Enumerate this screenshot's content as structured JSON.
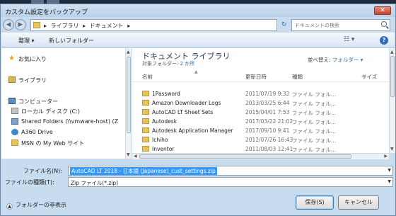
{
  "window": {
    "title": "カスタム設定をバックアップ",
    "close_label": "✕"
  },
  "address": {
    "crumbs": [
      "ライブラリ",
      "ドキュメント"
    ],
    "separator": "▸",
    "search_placeholder": "ドキュメントの検索"
  },
  "toolbar": {
    "organize_label": "整理 ▾",
    "new_folder_label": "新しいフォルダー",
    "views_label": "☷ ▾",
    "help_label": "?"
  },
  "nav": {
    "items": [
      {
        "label": "お気に入り",
        "icon": "star-icon"
      },
      {
        "label": "ライブラリ",
        "icon": "library-icon"
      },
      {
        "label": "コンピューター",
        "icon": "computer-icon"
      },
      {
        "label": "ローカル ディスク (C:)",
        "icon": "disk-icon"
      },
      {
        "label": "Shared Folders (\\\\vmware-host) (Z",
        "icon": "network-drive-icon"
      },
      {
        "label": "A360 Drive",
        "icon": "a360-icon"
      },
      {
        "label": "MSN の My Web サイト",
        "icon": "msn-icon"
      }
    ]
  },
  "library": {
    "title": "ドキュメント ライブラリ",
    "subtitle_prefix": "対象フォルダー: ",
    "location_count": "2 か所",
    "arrange_label": "並べ替え: ",
    "arrange_value": "フォルダー ▾"
  },
  "columns": {
    "name": "名前",
    "date": "更新日時",
    "type": "種類",
    "size": "サイズ"
  },
  "files": [
    {
      "name": "1Password",
      "date": "2011/07/19 9:32",
      "type": "ファイル フォル..."
    },
    {
      "name": "Amazon Downloader Logs",
      "date": "2013/03/25 6:44",
      "type": "ファイル フォル..."
    },
    {
      "name": "AutoCAD LT Sheet Sets",
      "date": "2015/04/01 7:53",
      "type": "ファイル フォル..."
    },
    {
      "name": "Autodesk",
      "date": "2017/03/22 21:02",
      "type": "ファイル フォル..."
    },
    {
      "name": "Autodesk Application Manager",
      "date": "2017/09/10 9:41",
      "type": "ファイル フォル..."
    },
    {
      "name": "Ichiho",
      "date": "2012/07/26 16:43",
      "type": "ファイル フォル..."
    },
    {
      "name": "Inventor",
      "date": "2011/08/03 12:41",
      "type": "ファイル フォル..."
    }
  ],
  "form": {
    "filename_label": "ファイル名(N):",
    "filename_value": "AutoCAD LT 2018 - 日本語 (Japanese)_cust_settings.zip",
    "filetype_label": "ファイルの種類(T):",
    "filetype_value": "Zip ファイル(*.zip)"
  },
  "footer": {
    "hide_folders_label": "フォルダーの非表示",
    "save_label": "保存(S)",
    "cancel_label": "キャンセル"
  },
  "colors": {
    "accent": "#3399ff",
    "title_blue": "#1e395b",
    "link": "#2a6dcd"
  }
}
